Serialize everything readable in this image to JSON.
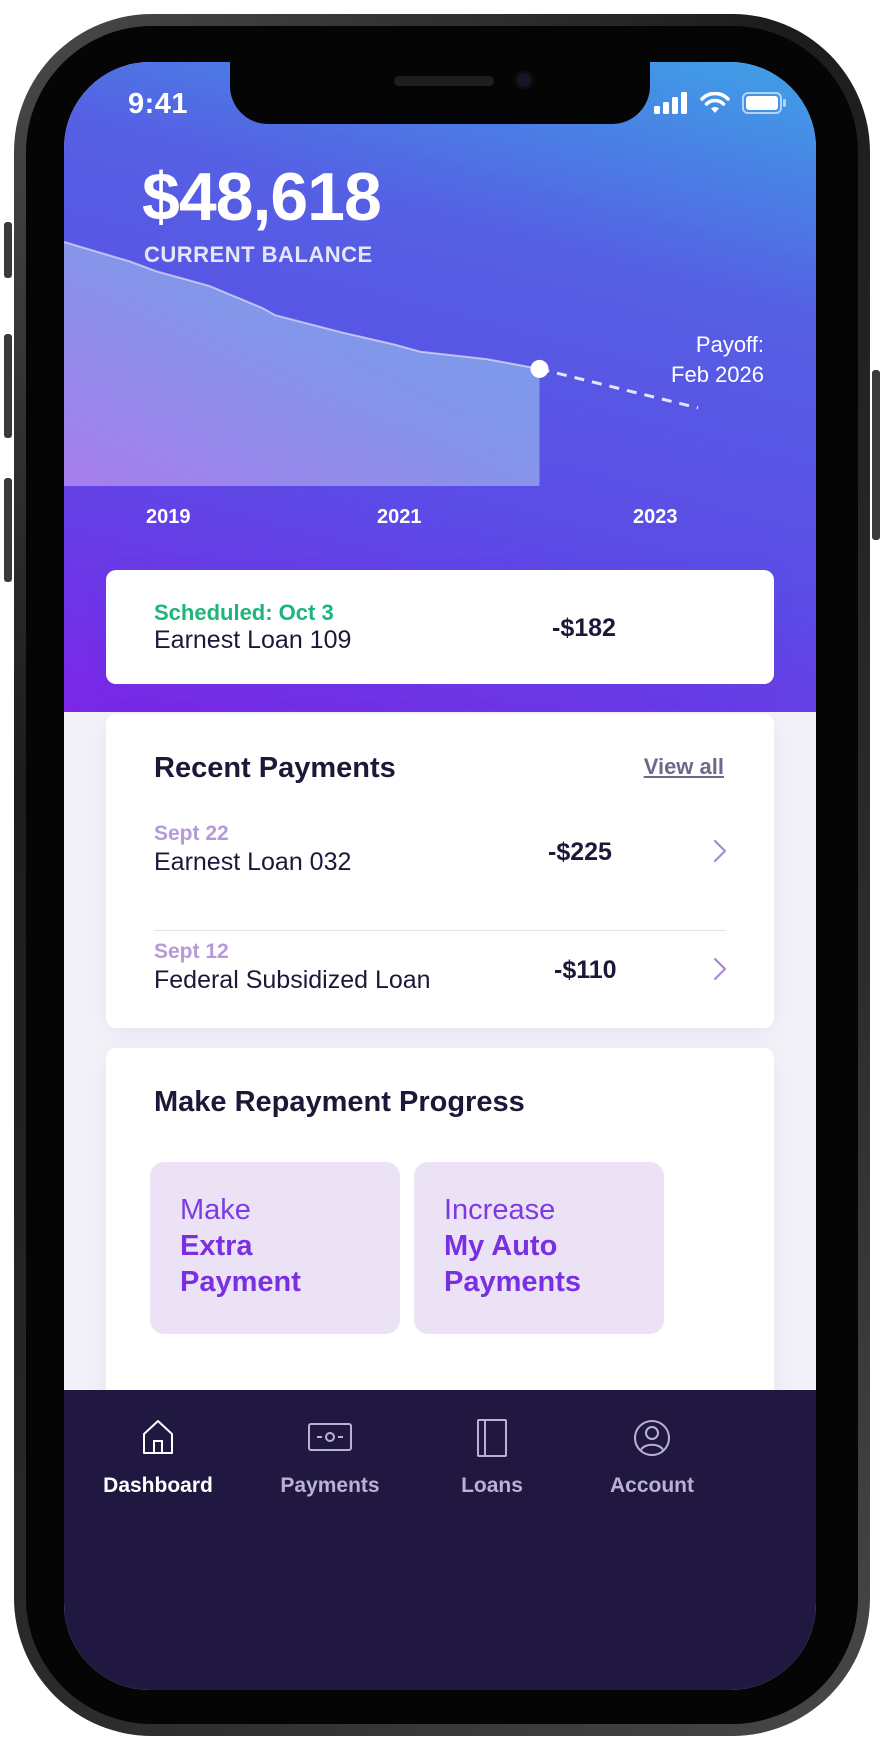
{
  "status_bar": {
    "time": "9:41"
  },
  "balance": {
    "amount": "$48,618",
    "label": "CURRENT BALANCE"
  },
  "chart_data": {
    "type": "area",
    "x": [
      2018.4,
      2018.9,
      2019.1,
      2019.5,
      2019.9,
      2020.0,
      2020.5,
      2020.9,
      2021.1,
      2021.6,
      2022.0
    ],
    "values": [
      1.0,
      0.92,
      0.88,
      0.82,
      0.73,
      0.7,
      0.63,
      0.58,
      0.55,
      0.52,
      0.48
    ],
    "projection": {
      "x": [
        2022.0,
        2023.2
      ],
      "values": [
        0.48,
        0.32
      ]
    },
    "x_ticks": [
      "2019",
      "2021",
      "2023"
    ],
    "payoff_label_line1": "Payoff:",
    "payoff_label_line2": "Feb 2026"
  },
  "scheduled": {
    "label": "Scheduled: Oct 3",
    "loan": "Earnest Loan 109",
    "amount": "-$182"
  },
  "recent_payments": {
    "title": "Recent Payments",
    "view_all": "View all",
    "items": [
      {
        "date": "Sept 22",
        "loan": "Earnest Loan 032",
        "amount": "-$225"
      },
      {
        "date": "Sept 12",
        "loan": "Federal Subsidized Loan",
        "amount": "-$110"
      }
    ]
  },
  "progress": {
    "title": "Make Repayment Progress",
    "actions": [
      {
        "line1": "Make",
        "line2": "Extra",
        "line3": "Payment"
      },
      {
        "line1": "Increase",
        "line2": "My Auto",
        "line3": "Payments"
      }
    ]
  },
  "tabs": [
    {
      "label": "Dashboard",
      "icon": "home-icon",
      "active": true
    },
    {
      "label": "Payments",
      "icon": "cash-icon",
      "active": false
    },
    {
      "label": "Loans",
      "icon": "book-icon",
      "active": false
    },
    {
      "label": "Account",
      "icon": "user-circle-icon",
      "active": false
    }
  ],
  "colors": {
    "accent": "#7b2fe2",
    "scheduled_green": "#1db57c",
    "tabbar_bg": "#211842",
    "tile_bg": "#ebe3f5"
  }
}
